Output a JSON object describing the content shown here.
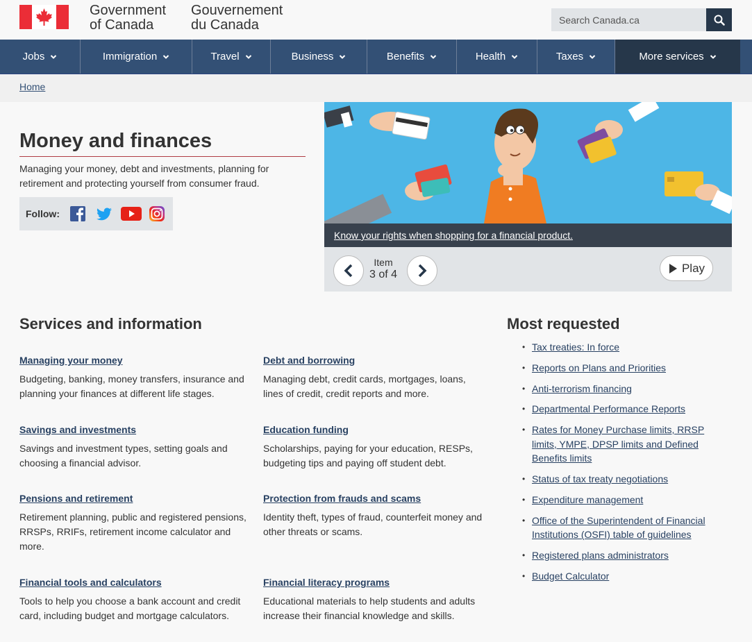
{
  "header": {
    "signature_en_line1": "Government",
    "signature_en_line2": "of Canada",
    "signature_fr_line1": "Gouvernement",
    "signature_fr_line2": "du Canada",
    "search_placeholder": "Search Canada.ca",
    "search_icon": "search-icon"
  },
  "nav": {
    "items": [
      {
        "label": "Jobs"
      },
      {
        "label": "Immigration"
      },
      {
        "label": "Travel"
      },
      {
        "label": "Business"
      },
      {
        "label": "Benefits"
      },
      {
        "label": "Health"
      },
      {
        "label": "Taxes"
      },
      {
        "label": "More services"
      }
    ]
  },
  "breadcrumb": {
    "home": "Home"
  },
  "intro": {
    "title": "Money and finances",
    "description": "Managing your money, debt and investments, planning for retirement and protecting yourself from consumer fraud.",
    "follow_label": "Follow:",
    "social_icons": [
      "facebook-icon",
      "twitter-icon",
      "youtube-icon",
      "instagram-icon"
    ]
  },
  "carousel": {
    "caption": "Know your rights when shopping for a financial product.",
    "item_label": "Item",
    "item_count": "3 of 4",
    "play_label": "Play"
  },
  "services": {
    "title": "Services and information",
    "items": [
      {
        "title": "Managing your money",
        "desc": "Budgeting, banking, money transfers, insurance and planning your finances at different life stages."
      },
      {
        "title": "Debt and borrowing",
        "desc": "Managing debt, credit cards, mortgages, loans, lines of credit, credit reports and more."
      },
      {
        "title": "Savings and investments",
        "desc": "Savings and investment types, setting goals and choosing a financial advisor."
      },
      {
        "title": "Education funding",
        "desc": "Scholarships, paying for your education, RESPs, budgeting tips and paying off student debt."
      },
      {
        "title": "Pensions and retirement",
        "desc": "Retirement planning, public and registered pensions, RRSPs, RRIFs, retirement income calculator and more."
      },
      {
        "title": "Protection from frauds and scams",
        "desc": "Identity theft, types of fraud, counterfeit money and other threats or scams."
      },
      {
        "title": "Financial tools and calculators",
        "desc": "Tools to help you choose a bank account and credit card, including budget and mortgage calculators."
      },
      {
        "title": "Financial literacy programs",
        "desc": "Educational materials to help students and adults increase their financial knowledge and skills."
      }
    ]
  },
  "most_requested": {
    "title": "Most requested",
    "items": [
      "Tax treaties: In force",
      "Reports on Plans and Priorities",
      "Anti-terrorism financing",
      "Departmental Performance Reports",
      "Rates for Money Purchase limits, RRSP limits, YMPE, DPSP limits and Defined Benefits limits",
      "Status of tax treaty negotiations",
      "Expenditure management",
      "Office of the Superintendent of Financial Institutions (OSFI) table of guidelines",
      "Registered plans administrators",
      "Budget Calculator"
    ]
  },
  "colors": {
    "nav_bg": "#335075",
    "nav_more_bg": "#26374a",
    "link": "#284162",
    "accent_red": "#af3c43"
  }
}
